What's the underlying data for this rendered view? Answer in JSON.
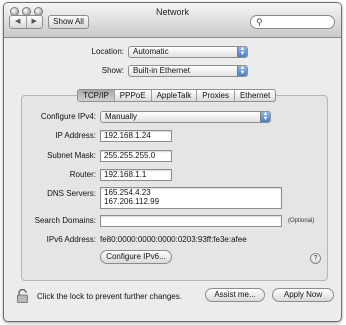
{
  "window": {
    "title": "Network"
  },
  "toolbar": {
    "back_icon": "◀",
    "forward_icon": "▶",
    "show_all_label": "Show All",
    "search_placeholder": ""
  },
  "location": {
    "label": "Location:",
    "value": "Automatic"
  },
  "show": {
    "label": "Show:",
    "value": "Built-in Ethernet"
  },
  "tabs": [
    {
      "label": "TCP/IP",
      "active": true
    },
    {
      "label": "PPPoE",
      "active": false
    },
    {
      "label": "AppleTalk",
      "active": false
    },
    {
      "label": "Proxies",
      "active": false
    },
    {
      "label": "Ethernet",
      "active": false
    }
  ],
  "tcpip": {
    "configure_label": "Configure IPv4:",
    "configure_value": "Manually",
    "ip_label": "IP Address:",
    "ip_value": "192.168.1.24",
    "subnet_label": "Subnet Mask:",
    "subnet_value": "255.255.255.0",
    "router_label": "Router:",
    "router_value": "192.168.1.1",
    "dns_label": "DNS Servers:",
    "dns_values": [
      "165.254.4.23",
      "167.206.112.99"
    ],
    "search_domains_label": "Search Domains:",
    "search_domains_value": "",
    "optional_label": "(Optional)",
    "ipv6_label": "IPv6 Address:",
    "ipv6_value": "fe80:0000:0000:0000:0203:93ff:fe3e:afee",
    "configure_ipv6_label": "Configure IPv6...",
    "help_label": "?"
  },
  "footer": {
    "lock_text": "Click the lock to prevent further changes.",
    "assist_label": "Assist me...",
    "apply_label": "Apply Now"
  }
}
